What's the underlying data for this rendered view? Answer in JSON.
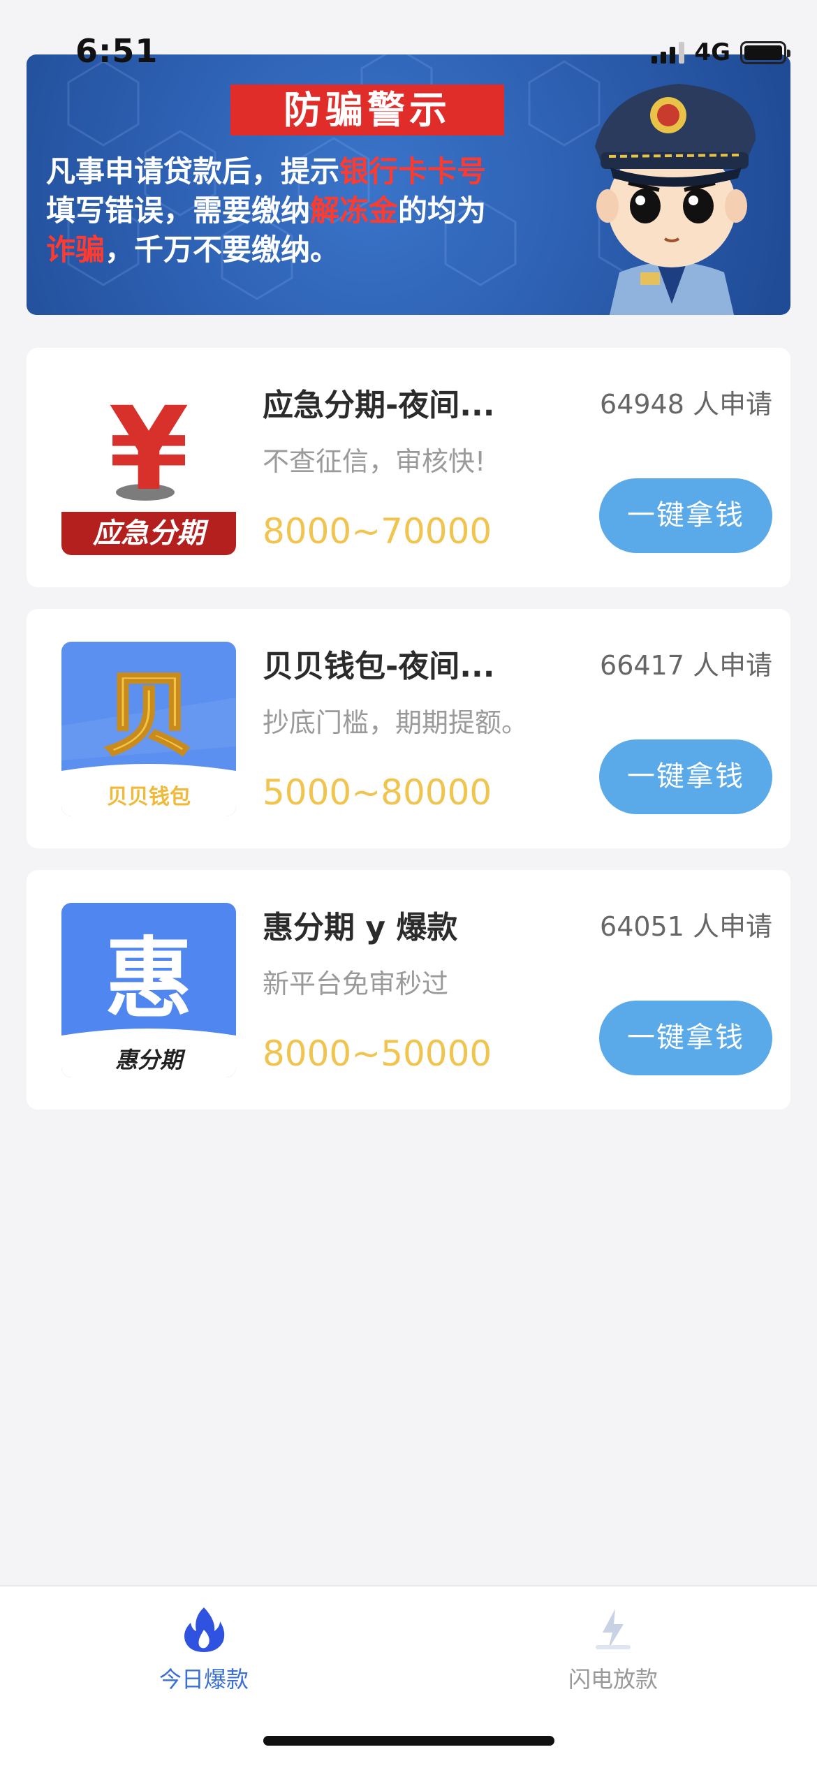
{
  "status": {
    "time": "6:51",
    "network": "4G"
  },
  "banner": {
    "title": "防骗警示",
    "text_parts": [
      "凡事申请贷款后，提示",
      "银行卡卡号",
      "填写错误，需要缴纳",
      "解冻金",
      "的均为",
      "诈骗",
      "，千万不要缴纳。"
    ]
  },
  "products": [
    {
      "name": "应急分期-夜间...",
      "desc": "不查征信，审核快!",
      "range": "8000~70000",
      "applicants": "64948 人申请",
      "button": "一键拿钱",
      "logo_text": "应急分期",
      "logo_glyph": "¥"
    },
    {
      "name": "贝贝钱包-夜间...",
      "desc": "抄底门槛，期期提额。",
      "range": "5000~80000",
      "applicants": "66417 人申请",
      "button": "一键拿钱",
      "logo_text": "贝贝钱包",
      "logo_glyph": "贝"
    },
    {
      "name": "惠分期 y 爆款",
      "desc": "新平台免审秒过",
      "range": "8000~50000",
      "applicants": "64051 人申请",
      "button": "一键拿钱",
      "logo_text": "惠分期",
      "logo_glyph": "惠"
    }
  ],
  "tabs": [
    {
      "label": "今日爆款",
      "icon": "flame-icon",
      "active": true
    },
    {
      "label": "闪电放款",
      "icon": "lightning-icon",
      "active": false
    }
  ],
  "colors": {
    "accent_button": "#5aa9e8",
    "range_gold": "#f0c44e",
    "warning_red": "#e02d2a",
    "active_tab": "#3a6fd8"
  }
}
